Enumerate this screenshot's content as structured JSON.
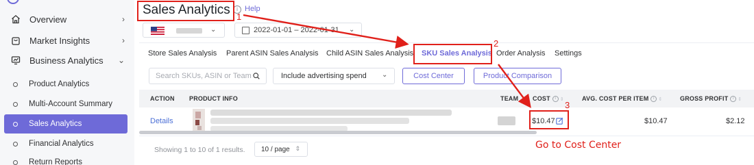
{
  "sidebar": {
    "items": [
      {
        "label": "Overview",
        "icon": "home-icon",
        "chevron": "›"
      },
      {
        "label": "Market Insights",
        "icon": "bag-icon",
        "chevron": "›"
      },
      {
        "label": "Business Analytics",
        "icon": "chart-monitor-icon",
        "chevron": "⌄"
      }
    ],
    "subitems": [
      {
        "label": "Product Analytics",
        "active": false
      },
      {
        "label": "Multi-Account Summary",
        "active": false
      },
      {
        "label": "Sales Analytics",
        "active": true
      },
      {
        "label": "Financial Analytics",
        "active": false
      },
      {
        "label": "Return Reports",
        "active": false
      }
    ]
  },
  "header": {
    "title": "Sales Analytics",
    "help_label": "Help",
    "date_range": "2022-01-01 – 2022-01-31"
  },
  "tabs": [
    {
      "label": "Store Sales Analysis",
      "active": false
    },
    {
      "label": "Parent ASIN Sales Analysis",
      "active": false
    },
    {
      "label": "Child ASIN Sales Analysis",
      "active": false
    },
    {
      "label": "SKU Sales Analysis",
      "active": true
    },
    {
      "label": "Order Analysis",
      "active": false
    },
    {
      "label": "Settings",
      "active": false
    }
  ],
  "toolbar": {
    "search_placeholder": "Search SKUs, ASIN or Team",
    "advertising_select": "Include advertising spend",
    "cost_center_button": "Cost Center",
    "product_comparison_button": "Product Comparison"
  },
  "table": {
    "columns": [
      "ACTION",
      "PRODUCT INFO",
      "TEAM",
      "COST",
      "AVG. COST PER ITEM",
      "GROSS PROFIT"
    ],
    "rows": [
      {
        "action": "Details",
        "cost": "$10.47",
        "avg_cost_per_item": "$10.47",
        "gross_profit": "$2.12"
      }
    ]
  },
  "pagination": {
    "summary": "Showing 1 to 10 of 1 results.",
    "page_size": "10 / page"
  },
  "annotations": {
    "step1": "1",
    "step2": "2",
    "step3": "3",
    "note": "Go to Cost Center"
  },
  "colors": {
    "accent": "#6e6ad8",
    "annotation_red": "#e0201a",
    "link_blue": "#4b6fd6"
  }
}
